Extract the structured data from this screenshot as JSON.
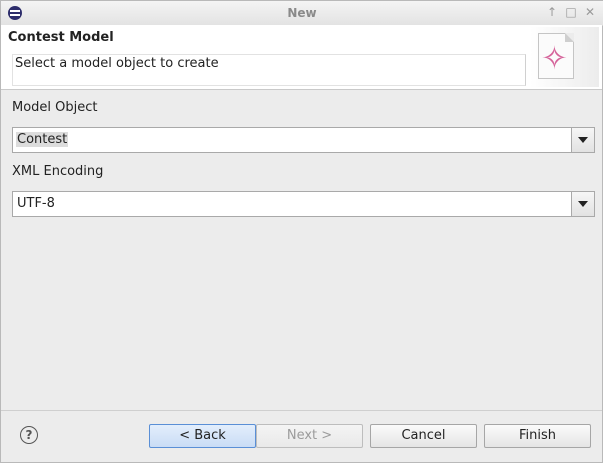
{
  "window": {
    "title": "New",
    "controls": [
      "↑",
      "□",
      "✕"
    ]
  },
  "header": {
    "title": "Contest Model",
    "message": "Select a model object to create",
    "banner_icon": "new-model-wizard-icon"
  },
  "form": {
    "model_object_label": "Model Object",
    "model_object_value": "Contest",
    "xml_encoding_label": "XML Encoding",
    "xml_encoding_value": "UTF-8"
  },
  "buttons": {
    "help": "?",
    "back": "< Back",
    "next": "Next >",
    "cancel": "Cancel",
    "finish": "Finish"
  }
}
